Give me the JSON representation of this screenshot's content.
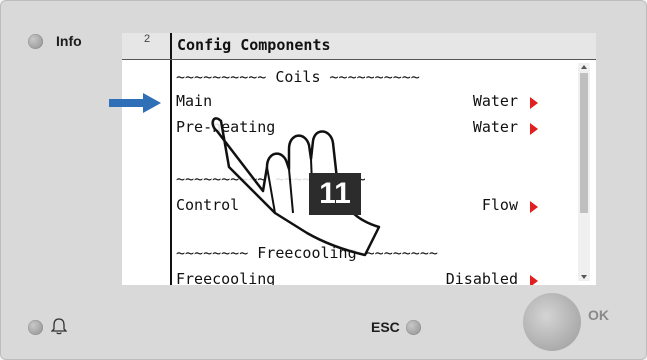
{
  "panel": {
    "info_label": "Info",
    "esc_label": "ESC",
    "ok_label": "OK",
    "bell_icon": "bell-icon"
  },
  "screen": {
    "page_number": "2",
    "title": "Config Components",
    "sections": [
      {
        "header": "~~~~~~~~~~ Coils ~~~~~~~~~~"
      },
      {
        "header": "~~~~~~~~~~ ~~~~~~~~~~"
      },
      {
        "header": "~~~~~~~~ Freecooling ~~~~~~~~"
      }
    ],
    "rows": [
      {
        "name": "Main",
        "value": "Water"
      },
      {
        "name": "Pre-heating",
        "value": "Water"
      },
      {
        "name": "Control",
        "value": "Flow"
      },
      {
        "name": "Freecooling",
        "value": "Disabled"
      }
    ]
  },
  "overlay": {
    "step_number": "11",
    "pointer_icon": "blue-arrow-icon",
    "hand_icon": "hand-pointer-icon"
  },
  "colors": {
    "arrow_red": "#e02020",
    "pointer_blue": "#2e6fb8"
  }
}
